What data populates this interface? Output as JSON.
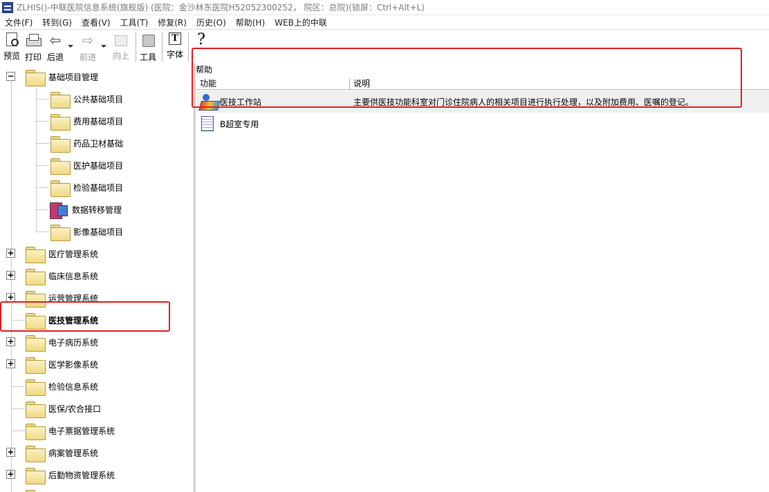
{
  "window": {
    "title": "ZLHIS()-中联医院信息系统(旗舰版) (医院：金沙林东医院H52052300252， 院区：总院)(锁屏：Ctrl+Alt+L)"
  },
  "menubar": {
    "items": [
      "文件(F)",
      "转到(G)",
      "查看(V)",
      "工具(T)",
      "修复(R)",
      "历史(O)",
      "帮助(H)",
      "WEB上的中联"
    ]
  },
  "toolbar": {
    "preview": "预览",
    "print": "打印",
    "back": "后退",
    "forward": "前进",
    "up": "向上",
    "tools": "工具",
    "font": "字体",
    "font_glyph": "T",
    "help_glyph": "?"
  },
  "tree": {
    "root": "基础项目管理",
    "children": [
      "公共基础项目",
      "费用基础项目",
      "药品卫材基础",
      "医护基础项目",
      "检验基础项目",
      "数据转移管理",
      "影像基础项目"
    ],
    "systems": [
      "医疗管理系统",
      "临床信息系统",
      "运营管理系统",
      "医技管理系统",
      "电子病历系统",
      "医学影像系统",
      "检验信息系统",
      "医保/农合接口",
      "电子票据管理系统",
      "病案管理系统",
      "后勤物资管理系统"
    ]
  },
  "list": {
    "help_label": "帮助",
    "col_function": "功能",
    "col_desc": "说明",
    "rows": [
      {
        "name": "医技工作站",
        "desc": "主要供医技功能科室对门诊住院病人的相关项目进行执行处理，以及附加费用、医嘱的登记。"
      },
      {
        "name": "B超室专用",
        "desc": ""
      }
    ]
  }
}
